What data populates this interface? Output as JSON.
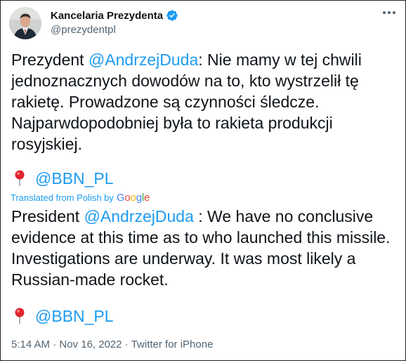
{
  "account": {
    "display_name": "Kancelaria Prezydenta",
    "handle": "@prezydentpl",
    "verified": true
  },
  "original": {
    "prefix": "Prezydent ",
    "mention": "@AndrzejDuda",
    "body": ": Nie mamy w tej chwili jednoznacznych dowodów na to, kto wystrzelił tę rakietę. Prowadzone są czynności śledcze. Najparwdopodobniej była to rakieta produkcji rosyjskiej.",
    "tag_icon": "round-pushpin-icon",
    "tag": "@BBN_PL"
  },
  "translation_notice": {
    "label": "Translated from Polish by",
    "provider": "Google"
  },
  "translation": {
    "prefix": "President ",
    "mention": "@AndrzejDuda",
    "body": " : We have no conclusive evidence at this time as to who launched this missile. Investigations are underway. It was most likely a Russian-made rocket.",
    "tag_icon": "round-pushpin-icon",
    "tag": "@BBN_PL"
  },
  "meta": {
    "time": "5:14 AM",
    "date": "Nov 16, 2022",
    "separator": "·",
    "source": "Twitter for iPhone"
  },
  "colors": {
    "link": "#1d9bf0",
    "secondary_text": "#536471",
    "primary_text": "#0f1419"
  }
}
